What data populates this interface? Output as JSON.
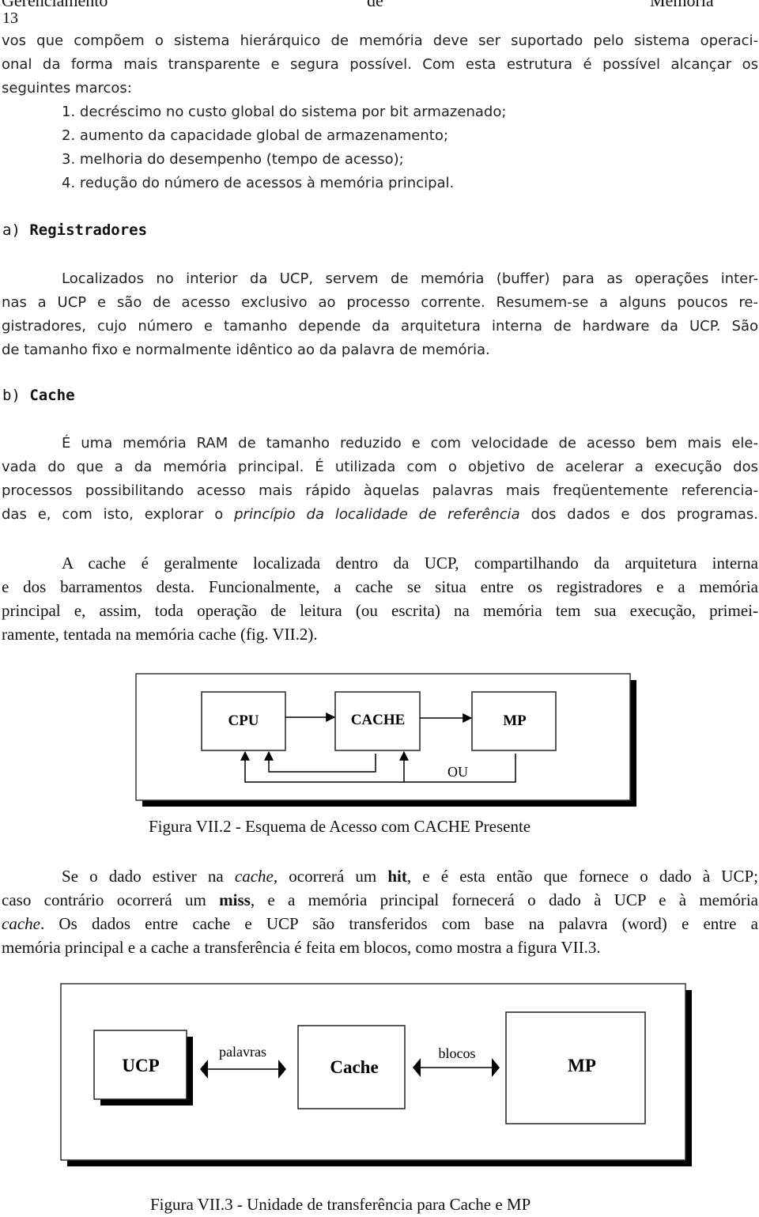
{
  "header": {
    "left": "Gerenciamento",
    "center": "de",
    "right": "Memória",
    "page_number": "13"
  },
  "intro": {
    "lines": [
      "vos que compõem o sistema hierárquico de memória deve ser suportado pelo sistema operaci-",
      "onal da forma mais transparente e segura possível. Com esta estrutura é possível alcançar os",
      "seguintes marcos:"
    ]
  },
  "goals": [
    "1. decréscimo no custo global do sistema por bit armazenado;",
    "2. aumento da capacidade global de armazenamento;",
    "3. melhoria do desempenho (tempo de acesso);",
    "4. redução do número de acessos à memória principal."
  ],
  "section_a": {
    "marker": "a)",
    "title": "Registradores",
    "lines": [
      "Localizados no interior da UCP, servem de memória (buffer) para as operações inter-",
      "nas a UCP e são de acesso exclusivo ao processo corrente. Resumem-se a alguns poucos re-",
      "gistradores, cujo número e tamanho depende da arquitetura interna de hardware da UCP.  São",
      "de tamanho fixo e normalmente idêntico ao da palavra de memória."
    ]
  },
  "section_b": {
    "marker": "b)",
    "title": "Cache",
    "para1": {
      "lines": [
        "É uma memória RAM de tamanho reduzido e com velocidade de acesso bem mais ele-",
        "vada do que a da memória principal. É utilizada com o objetivo de acelerar a execução dos",
        "processos possibilitando acesso mais rápido àquelas palavras mais freqüentemente referencia-"
      ],
      "last_line_before": "das e, com isto, explorar o ",
      "last_line_italic": "princípio da localidade de referência",
      "last_line_after": " dos dados e dos programas."
    },
    "para2": {
      "lines": [
        "A cache é geralmente localizada dentro da UCP, compartilhando da arquitetura interna",
        "e dos barramentos desta. Funcionalmente, a cache se situa entre os registradores e a memória",
        "principal e, assim, toda operação de leitura (ou escrita) na memória tem sua execução, primei-",
        "ramente, tentada na memória cache (fig. VII.2)."
      ]
    }
  },
  "figure1": {
    "boxes": [
      "CPU",
      "CACHE",
      "MP"
    ],
    "or_label": "OU",
    "caption": "Figura VII.2 - Esquema de Acesso com CACHE Presente"
  },
  "para3": {
    "l1_a": "Se o dado estiver na ",
    "l1_i": "cache",
    "l1_b": ", ocorrerá um ",
    "l1_bold": "hit",
    "l1_c": ", e é esta então que fornece o dado à UCP;",
    "l2_a": "caso contrário ocorrerá um ",
    "l2_bold": "miss",
    "l2_b": ", e a memória principal fornecerá o dado à UCP e à memória",
    "l3_i": "cache",
    "l3_b": ". Os dados entre cache e UCP são transferidos com base na palavra (word) e entre a",
    "l4": "memória principal e a cache a transferência é feita em blocos, como mostra a figura VII.3."
  },
  "figure2": {
    "boxes": [
      "UCP",
      "Cache",
      "MP"
    ],
    "arrow_labels": [
      "palavras",
      "blocos"
    ],
    "caption": "Figura VII.3 - Unidade de transferência para Cache e MP"
  }
}
